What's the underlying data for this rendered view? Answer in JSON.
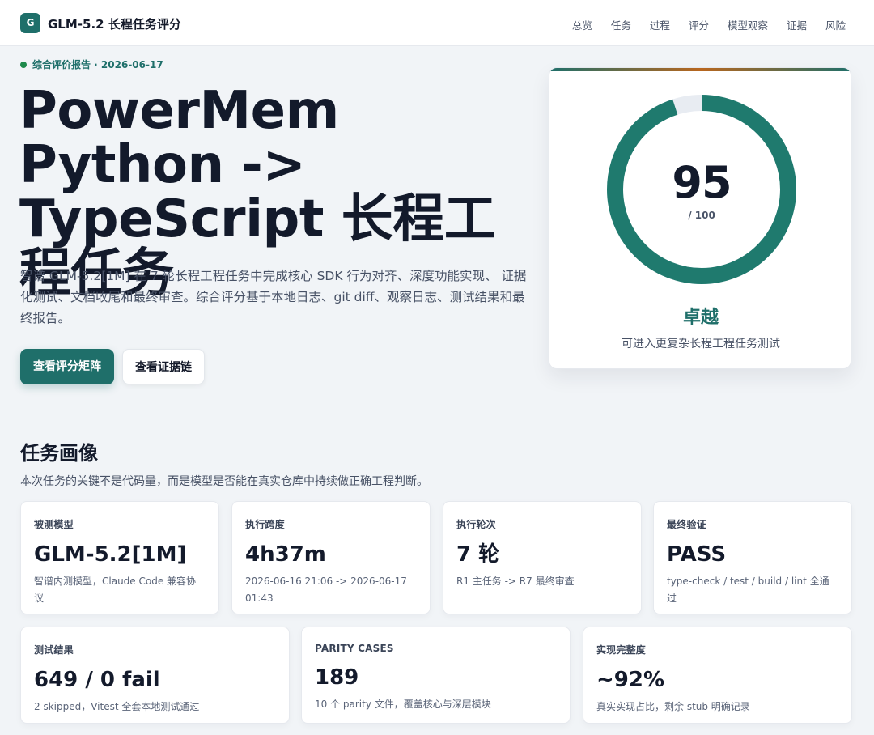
{
  "header": {
    "logo_letter": "G",
    "brand": "GLM-5.2 长程任务评分",
    "nav": [
      "总览",
      "任务",
      "过程",
      "评分",
      "模型观察",
      "证据",
      "风险"
    ]
  },
  "hero": {
    "eyebrow": "综合评价报告 · 2026-06-17",
    "title": "PowerMem Python -> TypeScript 长程工程任务",
    "description": "智谱 GLM-5.2[1M] 在 7 轮长程工程任务中完成核心 SDK 行为对齐、深度功能实现、 证据化测试、文档收尾和最终审查。综合评分基于本地日志、git diff、观察日志、测试结果和最终报告。",
    "primary_button": "查看评分矩阵",
    "secondary_button": "查看证据链"
  },
  "score": {
    "value": "95",
    "denominator": "/ 100",
    "fraction": 0.95,
    "grade": "卓越",
    "grade_desc": "可进入更复杂长程工程任务测试",
    "ring_color": "#1f7a6e",
    "track_color": "#e8ecf2"
  },
  "portrait": {
    "title": "任务画像",
    "subtitle": "本次任务的关键不是代码量，而是模型是否能在真实仓库中持续做正确工程判断。",
    "row1": [
      {
        "label": "被测模型",
        "value": "GLM-5.2[1M]",
        "note": "智谱内测模型，Claude Code 兼容协议"
      },
      {
        "label": "执行跨度",
        "value": "4h37m",
        "note": "2026-06-16 21:06 -> 2026-06-17 01:43"
      },
      {
        "label": "执行轮次",
        "value": "7 轮",
        "note": "R1 主任务 -> R7 最终审查"
      },
      {
        "label": "最终验证",
        "value": "PASS",
        "note": "type-check / test / build / lint 全通过"
      }
    ],
    "row2": [
      {
        "label": "测试结果",
        "value": "649 / 0 fail",
        "note": "2 skipped，Vitest 全套本地测试通过"
      },
      {
        "label": "PARITY CASES",
        "value": "189",
        "note": "10 个 parity 文件，覆盖核心与深层模块"
      },
      {
        "label": "实现完整度",
        "value": "~92%",
        "note": "真实实现占比，剩余 stub 明确记录"
      }
    ]
  }
}
